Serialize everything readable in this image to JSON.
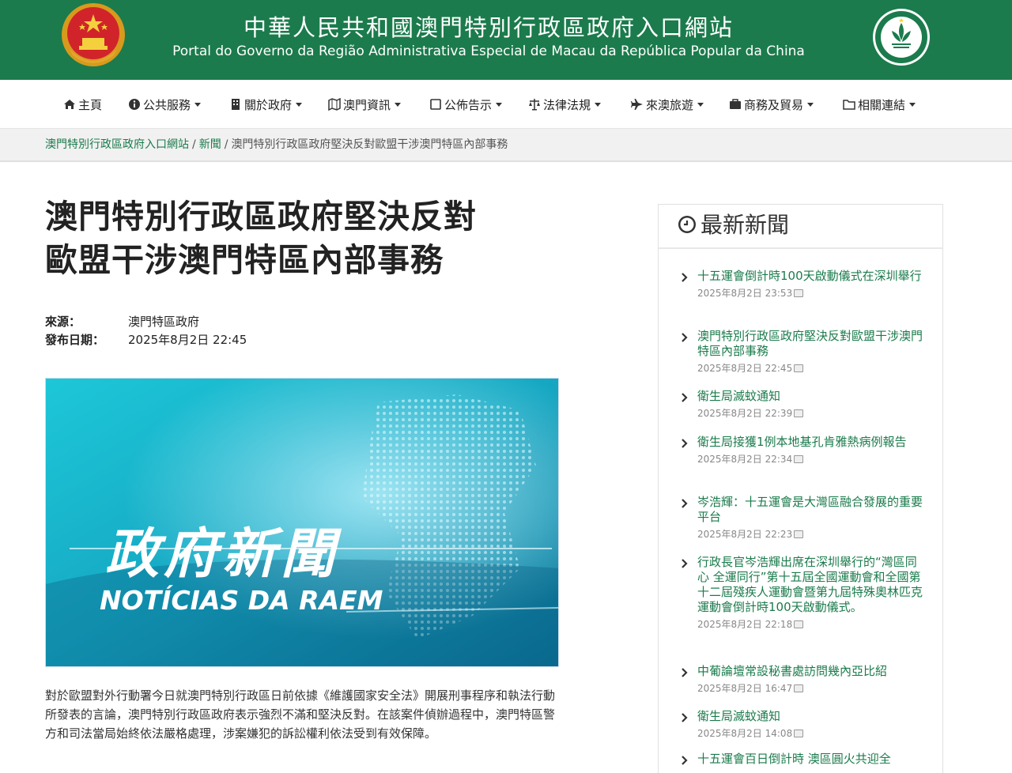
{
  "header": {
    "title_zh": "中華人民共和國澳門特別行政區政府入口網站",
    "title_pt": "Portal do Governo da Região Administrativa Especial de Macau da República Popular da China"
  },
  "nav": {
    "items": [
      {
        "label": "主頁",
        "icon": "home-icon"
      },
      {
        "label": "公共服務",
        "icon": "info-icon"
      },
      {
        "label": "關於政府",
        "icon": "building-icon"
      },
      {
        "label": "澳門資訊",
        "icon": "map-icon"
      },
      {
        "label": "公佈告示",
        "icon": "square-icon"
      },
      {
        "label": "法律法規",
        "icon": "scale-icon"
      },
      {
        "label": "來澳旅遊",
        "icon": "plane-icon"
      },
      {
        "label": "商務及貿易",
        "icon": "briefcase-icon"
      },
      {
        "label": "相關連結",
        "icon": "folder-icon"
      }
    ]
  },
  "breadcrumb": {
    "home": "澳門特別行政區政府入口網站",
    "section": "新聞",
    "separator": "/",
    "current": "澳門特別行政區政府堅決反對歐盟干涉澳門特區內部事務"
  },
  "article": {
    "title_line1": "澳門特別行政區政府堅決反對",
    "title_line2": "歐盟干涉澳門特區內部事務",
    "source_label": "來源：",
    "source_value": "澳門特區政府",
    "date_label": "發布日期：",
    "date_value": "2025年8月2日 22:45",
    "banner_title": "政府新聞",
    "banner_subtitle": "NOTÍCIAS DA RAEM",
    "body": "對於歐盟對外行動署今日就澳門特別行政區日前依據《維護國家安全法》開展刑事程序和執法行動所發表的言論，澳門特別行政區政府表示強烈不滿和堅決反對。在該案件偵辦過程中，澳門特區警方和司法當局始終依法嚴格處理，涉案嫌犯的訴訟權利依法受到有效保障。"
  },
  "sidebar": {
    "title": "最新新聞",
    "items": [
      {
        "title": "十五運會倒計時100天啟動儀式在深圳舉行",
        "date": "2025年8月2日 23:53"
      },
      {
        "title": "澳門特別行政區政府堅決反對歐盟干涉澳門特區內部事務",
        "date": "2025年8月2日 22:45"
      },
      {
        "title": "衛生局滅蚊通知",
        "date": "2025年8月2日 22:39"
      },
      {
        "title": "衛生局接獲1例本地基孔肯雅熱病例報告",
        "date": "2025年8月2日 22:34"
      },
      {
        "title": "岑浩輝：十五運會是大灣區融合發展的重要平台",
        "date": "2025年8月2日 22:23"
      },
      {
        "title": "行政長官岑浩輝出席在深圳舉行的“灣區同心 全運同行”第十五屆全國運動會和全國第十二屆殘疾人運動會暨第九屆特殊奧林匹克運動會倒計時100天啟動儀式。",
        "date": "2025年8月2日 22:18"
      },
      {
        "title": "中葡論壇常設秘書處訪問幾內亞比紹",
        "date": "2025年8月2日 16:47"
      },
      {
        "title": "衛生局滅蚊通知",
        "date": "2025年8月2日 14:08"
      },
      {
        "title": "十五運會百日倒計時 澳區圓火共迎全",
        "date": ""
      }
    ]
  },
  "colors": {
    "brand_green": "#1b7b4c",
    "link_green": "#1b7b4c"
  }
}
